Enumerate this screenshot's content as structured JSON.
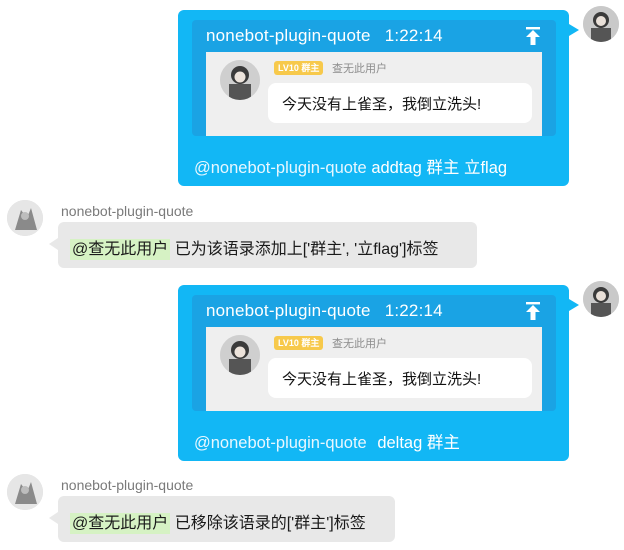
{
  "messages": [
    {
      "direction": "outgoing",
      "reply": {
        "title": "nonebot-plugin-quote",
        "time": "1:22:14",
        "level_badge": "LV10 群主",
        "quoted_user": "查无此用户",
        "quoted_text": "今天没有上雀圣，我倒立洗头!"
      },
      "mention": "@nonebot-plugin-quote",
      "command": "addtag 群主 立flag"
    },
    {
      "direction": "incoming",
      "sender": "nonebot-plugin-quote",
      "mention": "@查无此用户",
      "text": "已为该语录添加上['群主', '立flag']标签"
    },
    {
      "direction": "outgoing",
      "reply": {
        "title": "nonebot-plugin-quote",
        "time": "1:22:14",
        "level_badge": "LV10 群主",
        "quoted_user": "查无此用户",
        "quoted_text": "今天没有上雀圣，我倒立洗头!"
      },
      "mention": "@nonebot-plugin-quote",
      "command": "deltag 群主"
    },
    {
      "direction": "incoming",
      "sender": "nonebot-plugin-quote",
      "mention": "@查无此用户",
      "text": "已移除该语录的['群主']标签"
    }
  ],
  "icons": {
    "pin": "pin-to-top-icon",
    "avatar": "user-avatar"
  },
  "colors": {
    "outgoing_bubble": "#12b7f5",
    "reply_card": "#1aa3e4",
    "incoming_bubble": "#e8e8e8",
    "mention_chip": "#d6f2c4",
    "level_badge": "#f7c94b"
  }
}
